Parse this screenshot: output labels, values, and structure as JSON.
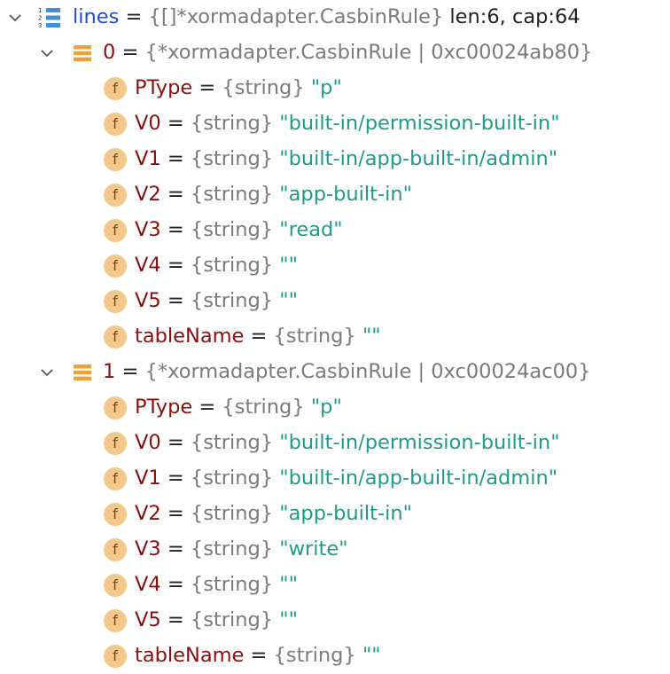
{
  "variables": {
    "root": {
      "name": "lines",
      "type": "{[]*xormadapter.CasbinRule}",
      "meta": "len:6, cap:64",
      "expanded": true,
      "icon": "array-icon"
    },
    "elements": [
      {
        "index": "0",
        "type": "{*xormadapter.CasbinRule | 0xc00024ab80}",
        "expanded": true,
        "icon": "struct-icon",
        "fields": [
          {
            "name": "PType",
            "type": "{string}",
            "value": "\"p\""
          },
          {
            "name": "V0",
            "type": "{string}",
            "value": "\"built-in/permission-built-in\""
          },
          {
            "name": "V1",
            "type": "{string}",
            "value": "\"built-in/app-built-in/admin\""
          },
          {
            "name": "V2",
            "type": "{string}",
            "value": "\"app-built-in\""
          },
          {
            "name": "V3",
            "type": "{string}",
            "value": "\"read\""
          },
          {
            "name": "V4",
            "type": "{string}",
            "value": "\"\""
          },
          {
            "name": "V5",
            "type": "{string}",
            "value": "\"\""
          },
          {
            "name": "tableName",
            "type": "{string}",
            "value": "\"\""
          }
        ]
      },
      {
        "index": "1",
        "type": "{*xormadapter.CasbinRule | 0xc00024ac00}",
        "expanded": true,
        "icon": "struct-icon",
        "fields": [
          {
            "name": "PType",
            "type": "{string}",
            "value": "\"p\""
          },
          {
            "name": "V0",
            "type": "{string}",
            "value": "\"built-in/permission-built-in\""
          },
          {
            "name": "V1",
            "type": "{string}",
            "value": "\"built-in/app-built-in/admin\""
          },
          {
            "name": "V2",
            "type": "{string}",
            "value": "\"app-built-in\""
          },
          {
            "name": "V3",
            "type": "{string}",
            "value": "\"write\""
          },
          {
            "name": "V4",
            "type": "{string}",
            "value": "\"\""
          },
          {
            "name": "V5",
            "type": "{string}",
            "value": "\"\""
          },
          {
            "name": "tableName",
            "type": "{string}",
            "value": "\"\""
          }
        ]
      }
    ]
  },
  "labels": {
    "equals": " = ",
    "field_icon_letter": "f"
  },
  "colors": {
    "variable_name": "#1a4fd6",
    "field_name": "#8a0f0f",
    "type_text": "#7b7b7b",
    "string_value": "#1f9a8a",
    "field_icon_bg": "#f4c78a",
    "struct_icon": "#e8a33a"
  }
}
